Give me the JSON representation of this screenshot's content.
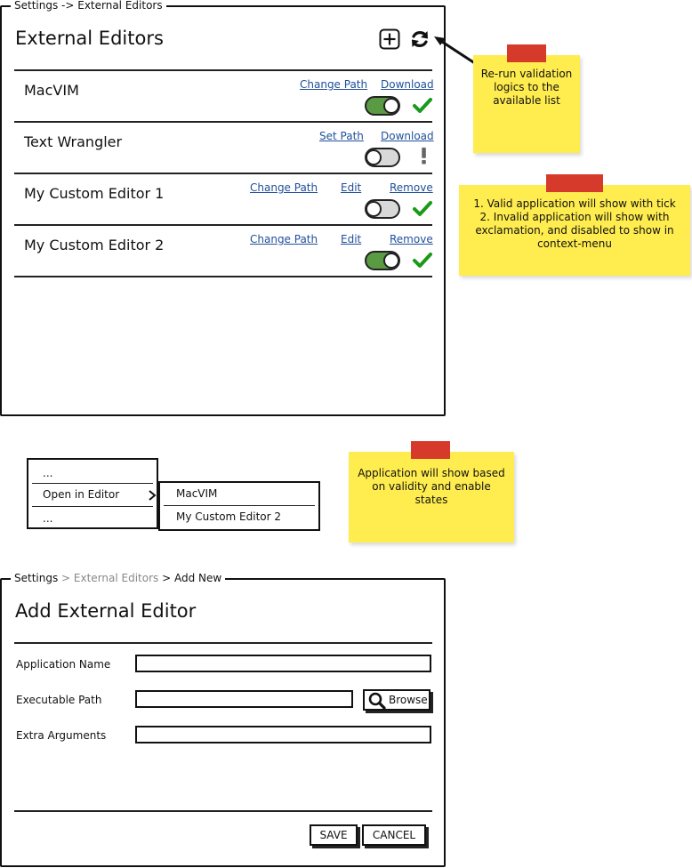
{
  "editors_panel": {
    "breadcrumb": "Settings -> External Editors",
    "title": "External Editors",
    "add_icon": "plus-square-icon",
    "refresh_icon": "refresh-icon",
    "editors": [
      {
        "name": "MacVIM",
        "links": [
          "Change Path",
          "Download"
        ],
        "enabled": true,
        "status": "valid"
      },
      {
        "name": "Text Wrangler",
        "links": [
          "Set Path",
          "Download"
        ],
        "enabled": false,
        "status": "invalid"
      },
      {
        "name": "My Custom Editor 1",
        "links": [
          "Change Path",
          "Edit",
          "Remove"
        ],
        "enabled": false,
        "status": "valid"
      },
      {
        "name": "My Custom Editor 2",
        "links": [
          "Change Path",
          "Edit",
          "Remove"
        ],
        "enabled": true,
        "status": "valid"
      }
    ]
  },
  "notes": {
    "rerun": "Re-run validation logics to the available list",
    "validity_1": "1. Valid application will show with tick",
    "validity_2": "2. Invalid application will show with exclamation, and disabled to show in context-menu",
    "menu_note": "Application will show based on validity and enable states"
  },
  "context_menu": {
    "items": [
      "...",
      "Open in Editor",
      "..."
    ],
    "submenu": [
      "MacVIM",
      "My Custom Editor 2"
    ]
  },
  "add_panel": {
    "breadcrumb_root": "Settings",
    "breadcrumb_mid": "> External Editors",
    "breadcrumb_leaf": "> Add New",
    "title": "Add External Editor",
    "fields": {
      "app_name_label": "Application Name",
      "app_name_value": "",
      "exec_path_label": "Executable Path",
      "exec_path_value": "",
      "extra_args_label": "Extra Arguments",
      "extra_args_value": ""
    },
    "browse_label": "Browse",
    "save_label": "SAVE",
    "cancel_label": "CANCEL"
  },
  "colors": {
    "link": "#1f4f9a",
    "check": "#1a9a1a",
    "toggle_on": "#5a9a43",
    "toggle_off": "#d8d8d8",
    "sticky": "#ffec4f",
    "tape": "#d63a2a",
    "exclamation": "#666666"
  }
}
